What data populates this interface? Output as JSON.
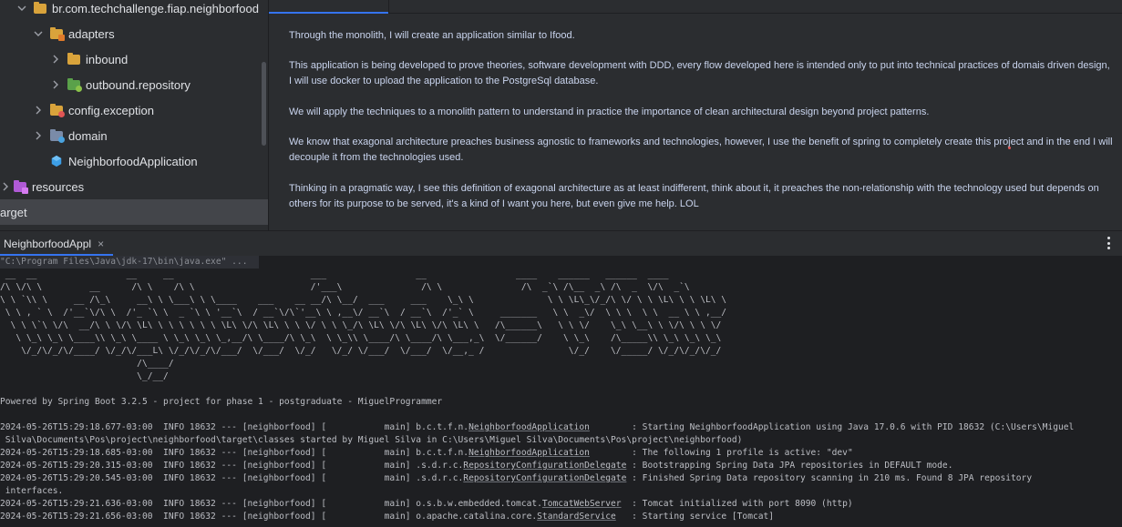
{
  "tree": {
    "items": [
      {
        "label": "br.com.techchallenge.fiap.neighborfood",
        "icon": "folder-icon",
        "chevron": "down",
        "color": "#d9a33b"
      },
      {
        "label": "adapters",
        "icon": "folder-icon",
        "chevron": "down",
        "color": "#d9a33b"
      },
      {
        "label": "inbound",
        "icon": "folder-icon",
        "chevron": "right",
        "color": "#d9a33b"
      },
      {
        "label": "outbound.repository",
        "icon": "folder-icon",
        "chevron": "right",
        "color": "#5aa14a"
      },
      {
        "label": "config.exception",
        "icon": "folder-icon",
        "chevron": "right",
        "color": "#d9a33b"
      },
      {
        "label": "domain",
        "icon": "folder-icon",
        "chevron": "right",
        "color": "#7a8ba8"
      },
      {
        "label": "NeighborfoodApplication",
        "icon": "spring-class-icon",
        "chevron": "",
        "color": "#3d9ee6"
      },
      {
        "label": "resources",
        "icon": "resources-folder-icon",
        "chevron": "right",
        "color": "#b05ad6"
      },
      {
        "label": "arget",
        "icon": "",
        "chevron": "",
        "color": ""
      }
    ]
  },
  "doc": {
    "paragraphs": [
      "Through the monolith, I will create an application similar to Ifood.",
      "This application is being developed to prove theories, software development with DDD, every flow developed here is intended only to put into technical practices of domais driven design, I will use docker to upload the application to the PostgreSql database.",
      "We will apply the techniques to a monolith pattern to understand in practice the importance of clean architectural design beyond project patterns.",
      "We know that exagonal architecture preaches business agnostic to frameworks and technologies, however, I use the benefit of spring to completely create this project and in the end I will decouple it from the technologies used.",
      "Thinking in a pragmatic way, I see this definition of exagonal architecture as at least indifferent, think about it, it preaches the non-relationship with the technology used but depends on others for its purpose to be served, it's a kind of I want you here, but even give me help. LOL"
    ]
  },
  "console": {
    "tab_label": "NeighborfoodAppl",
    "close_glyph": "×",
    "command": "\"C:\\Program Files\\Java\\jdk-17\\bin\\java.exe\" ...",
    "banner": " __  __                 __     __                          ___                 __                 ____    ______   ______  ____\n/\\ \\/\\ \\         __      /\\ \\    /\\ \\                      /'___\\               /\\ \\               /\\  _`\\ /\\__  _\\ /\\  _  \\/\\  _`\\\n\\ \\ `\\\\ \\     __ /\\_\\     __\\ \\ \\___\\ \\ \\____    ___    __ __/\\ \\__/  ___     ___    \\_\\ \\              \\ \\ \\L\\_\\/_/\\ \\/ \\ \\ \\L\\ \\ \\ \\L\\ \\\n \\ \\ , ` \\  /'__`\\/\\ \\  /'_ `\\ \\  _ `\\ \\ '__`\\  / __`\\/\\`'__\\ \\ ,__\\/ __`\\  / __`\\  /'_` \\     _______   \\ \\  _\\/  \\ \\ \\  \\ \\  __ \\ \\ ,__/\n  \\ \\ \\`\\ \\/\\  __/\\ \\ \\/\\ \\L\\ \\ \\ \\ \\ \\ \\ \\L\\ \\/\\ \\L\\ \\ \\ \\/ \\ \\ \\_/\\ \\L\\ \\/\\ \\L\\ \\/\\ \\L\\ \\   /\\______\\   \\ \\ \\/    \\_\\ \\__\\ \\ \\/\\ \\ \\ \\/\n   \\ \\_\\ \\_\\ \\____\\\\ \\_\\ \\____ \\ \\_\\ \\_\\ \\_,__/\\ \\____/\\ \\_\\  \\ \\_\\\\ \\____/\\ \\____/\\ \\___,_\\  \\/______/    \\ \\_\\    /\\_____\\\\ \\_\\ \\_\\ \\_\\\n    \\/_/\\/_/\\/____/ \\/_/\\/___L\\ \\/_/\\/_/\\/___/  \\/___/  \\/_/   \\/_/ \\/___/  \\/___/  \\/__,_ /                \\/_/    \\/_____/ \\/_/\\/_/\\/_/\n                          /\\____/\n                          \\_/__/",
    "powered_by": "Powered by Spring Boot 3.2.5 - project for phase 1 - postgraduate - MiguelProgrammer",
    "logs": [
      {
        "pre": "2024-05-26T15:29:18.677-03:00  INFO 18632 --- [neighborfood] [           main] b.c.t.f.n.",
        "cls": "NeighborfoodApplication",
        "post": "        : Starting NeighborfoodApplication using Java 17.0.6 with PID 18632 (C:\\Users\\Miguel"
      },
      {
        "pre": " Silva\\Documents\\Pos\\project\\neighborfood\\target\\classes started by Miguel Silva in C:\\Users\\Miguel Silva\\Documents\\Pos\\project\\neighborfood)",
        "cls": "",
        "post": ""
      },
      {
        "pre": "2024-05-26T15:29:18.685-03:00  INFO 18632 --- [neighborfood] [           main] b.c.t.f.n.",
        "cls": "NeighborfoodApplication",
        "post": "        : The following 1 profile is active: \"dev\""
      },
      {
        "pre": "2024-05-26T15:29:20.315-03:00  INFO 18632 --- [neighborfood] [           main] .s.d.r.c.",
        "cls": "RepositoryConfigurationDelegate",
        "post": " : Bootstrapping Spring Data JPA repositories in DEFAULT mode."
      },
      {
        "pre": "2024-05-26T15:29:20.545-03:00  INFO 18632 --- [neighborfood] [           main] .s.d.r.c.",
        "cls": "RepositoryConfigurationDelegate",
        "post": " : Finished Spring Data repository scanning in 210 ms. Found 8 JPA repository"
      },
      {
        "pre": " interfaces.",
        "cls": "",
        "post": ""
      },
      {
        "pre": "2024-05-26T15:29:21.636-03:00  INFO 18632 --- [neighborfood] [           main] o.s.b.w.embedded.tomcat.",
        "cls": "TomcatWebServer",
        "post": "  : Tomcat initialized with port 8090 (http)"
      },
      {
        "pre": "2024-05-26T15:29:21.656-03:00  INFO 18632 --- [neighborfood] [           main] o.apache.catalina.core.",
        "cls": "StandardService",
        "post": "   : Starting service [Tomcat]"
      }
    ]
  }
}
